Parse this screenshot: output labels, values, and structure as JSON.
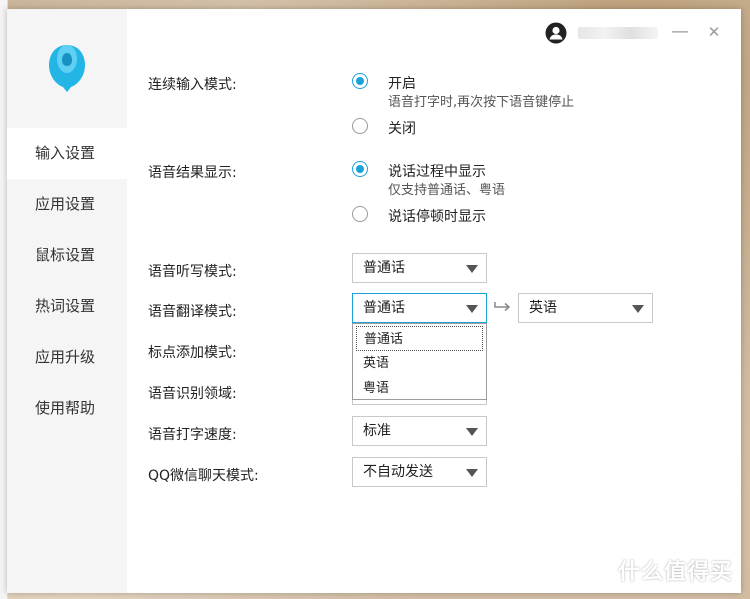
{
  "colors": {
    "accent": "#1aa3db",
    "sidebar_bg": "#f5f5f5"
  },
  "sidebar": {
    "items": [
      {
        "label": "输入设置",
        "active": true
      },
      {
        "label": "应用设置"
      },
      {
        "label": "鼠标设置"
      },
      {
        "label": "热词设置"
      },
      {
        "label": "应用升级"
      },
      {
        "label": "使用帮助"
      }
    ]
  },
  "titlebar": {
    "user_icon": "user-avatar-icon",
    "minimize": "—",
    "close": "✕"
  },
  "settings": {
    "continuous_input": {
      "label": "连续输入模式:",
      "options": [
        {
          "label": "开启",
          "sub": "语音打字时,再次按下语音键停止",
          "checked": true
        },
        {
          "label": "关闭",
          "checked": false
        }
      ]
    },
    "result_display": {
      "label": "语音结果显示:",
      "options": [
        {
          "label": "说话过程中显示",
          "sub": "仅支持普通话、粤语",
          "checked": true
        },
        {
          "label": "说话停顿时显示",
          "checked": false
        }
      ]
    },
    "dictation_mode": {
      "label": "语音听写模式:",
      "value": "普通话"
    },
    "translate_mode": {
      "label": "语音翻译模式:",
      "from": "普通话",
      "to": "英语",
      "dropdown_options": [
        "普通话",
        "英语",
        "粤语"
      ]
    },
    "punctuation_mode": {
      "label": "标点添加模式:"
    },
    "recognition_domain": {
      "label": "语音识别领域:"
    },
    "typing_speed": {
      "label": "语音打字速度:",
      "value": "标准"
    },
    "qq_wechat_mode": {
      "label": "QQ微信聊天模式:",
      "value": "不自动发送"
    }
  },
  "watermark": {
    "badge": "值",
    "text": "什么值得买"
  }
}
